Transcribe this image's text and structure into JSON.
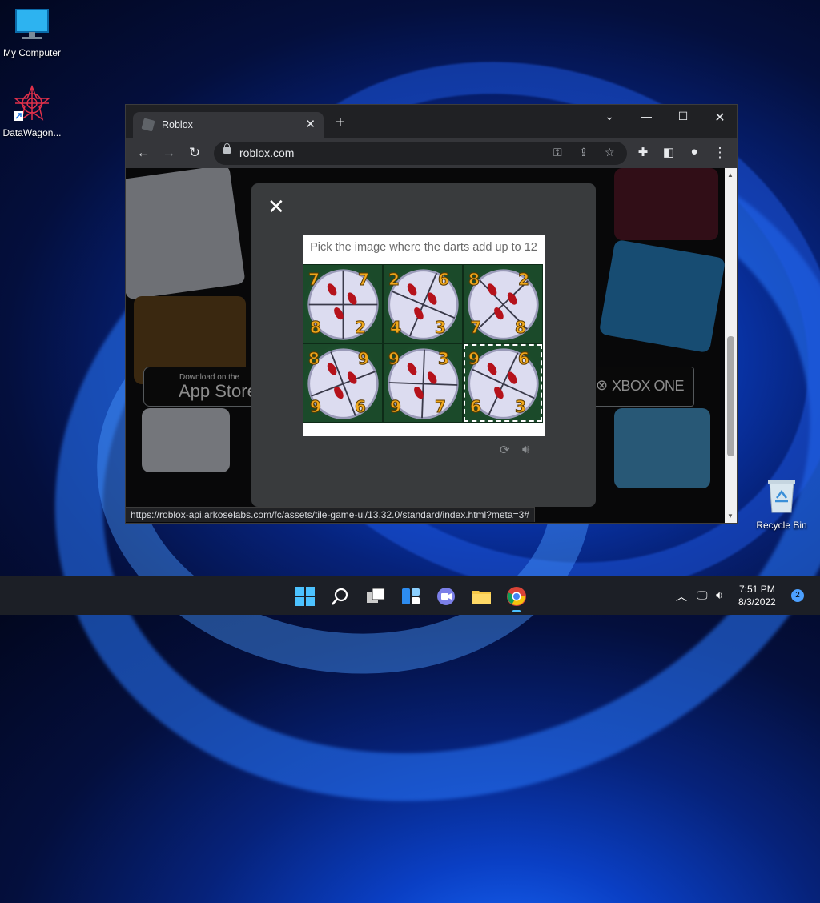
{
  "desktop": {
    "icons": [
      {
        "label": "My Computer"
      },
      {
        "label": "DataWagon..."
      },
      {
        "label": "Recycle Bin"
      }
    ]
  },
  "browser": {
    "tab_title": "Roblox",
    "tab_close": "✕",
    "new_tab": "+",
    "url": "roblox.com",
    "status_url": "https://roblox-api.arkoselabs.com/fc/assets/tile-game-ui/13.32.0/standard/index.html?meta=3#"
  },
  "page": {
    "app_store_small": "Download on the",
    "app_store_big": "App Store",
    "xbox": "XBOX ONE"
  },
  "captcha": {
    "prompt": "Pick the image where the darts add up to 12",
    "tiles": [
      {
        "numbers": [
          "7",
          "7",
          "8",
          "2"
        ],
        "selected": false
      },
      {
        "numbers": [
          "2",
          "6",
          "4",
          "3"
        ],
        "selected": false
      },
      {
        "numbers": [
          "8",
          "2",
          "7",
          "8"
        ],
        "selected": false
      },
      {
        "numbers": [
          "8",
          "9",
          "9",
          "6"
        ],
        "selected": false
      },
      {
        "numbers": [
          "9",
          "3",
          "9",
          "7"
        ],
        "selected": false
      },
      {
        "numbers": [
          "9",
          "6",
          "6",
          "3"
        ],
        "selected": true
      }
    ]
  },
  "taskbar": {
    "time": "7:51 PM",
    "date": "8/3/2022",
    "notifications": "2"
  }
}
